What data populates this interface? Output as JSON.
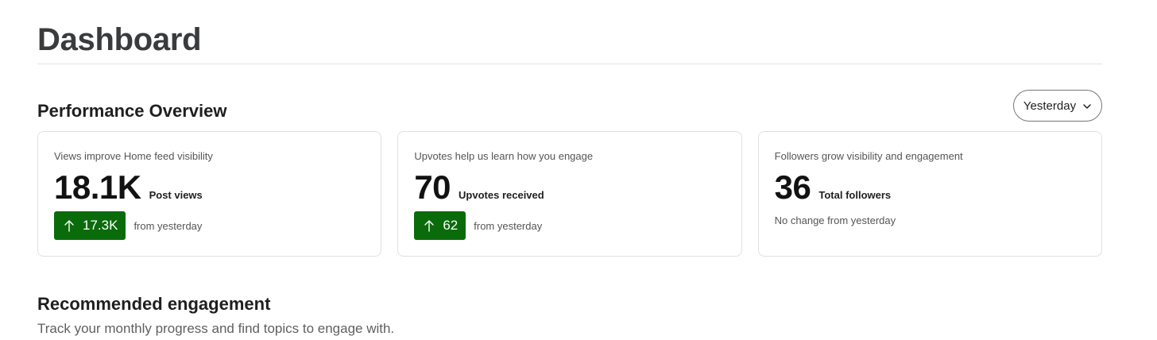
{
  "page": {
    "title": "Dashboard"
  },
  "performance": {
    "title": "Performance Overview",
    "period_select": {
      "value": "Yesterday",
      "icon": "chevron-down-icon"
    },
    "cards": [
      {
        "description": "Views improve Home feed visibility",
        "value": "18.1K",
        "label": "Post views",
        "change": {
          "icon": "arrow-up-icon",
          "value": "17.3K",
          "text": "from yesterday"
        }
      },
      {
        "description": "Upvotes help us learn how you engage",
        "value": "70",
        "label": "Upvotes received",
        "change": {
          "icon": "arrow-up-icon",
          "value": "62",
          "text": "from yesterday"
        }
      },
      {
        "description": "Followers grow visibility and engagement",
        "value": "36",
        "label": "Total followers",
        "no_change_text": "No change from yesterday"
      }
    ]
  },
  "recommended": {
    "title": "Recommended engagement",
    "subtitle": "Track your monthly progress and find topics to engage with."
  },
  "colors": {
    "positive_badge": "#0a6b0a",
    "card_border": "#e0e0e0"
  }
}
